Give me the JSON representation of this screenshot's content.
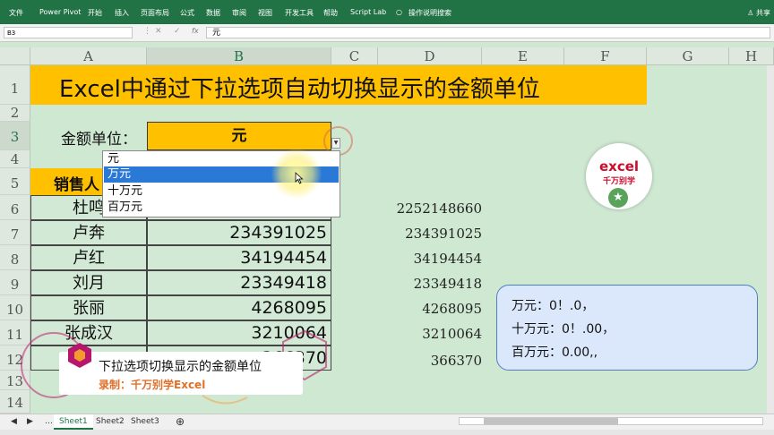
{
  "ribbon": {
    "tabs": [
      "文件",
      "Power Pivot",
      "开始",
      "插入",
      "页面布局",
      "公式",
      "数据",
      "审阅",
      "视图",
      "开发工具",
      "帮助",
      "Script Lab",
      "操作说明搜索"
    ],
    "share": "共享"
  },
  "formula_bar": {
    "name_box": "B3",
    "value": "元"
  },
  "columns": [
    "A",
    "B",
    "C",
    "D",
    "E",
    "F",
    "G",
    "H"
  ],
  "rows": [
    "1",
    "2",
    "3",
    "4",
    "5",
    "6",
    "7",
    "8",
    "9",
    "10",
    "11",
    "12",
    "13",
    "14"
  ],
  "sheet": {
    "title": "Excel中通过下拉选项自动切换显示的金额单位",
    "unit_label": "金额单位：",
    "unit_value": "元",
    "sales_header": "销售人",
    "data_rows": [
      {
        "name": "杜鸣",
        "value": ""
      },
      {
        "name": "卢奔",
        "value": "234391025"
      },
      {
        "name": "卢红",
        "value": "34194454"
      },
      {
        "name": "刘月",
        "value": "23349418"
      },
      {
        "name": "张丽",
        "value": "4268095"
      },
      {
        "name": "张成汉",
        "value": "3210064"
      },
      {
        "name": "",
        "value": "366370"
      }
    ],
    "column_d": [
      "2252148660",
      "234391025",
      "34194454",
      "23349418",
      "4268095",
      "3210064",
      "366370"
    ]
  },
  "dropdown": {
    "options": [
      "元",
      "万元",
      "十万元",
      "百万元"
    ],
    "highlighted_index": 1
  },
  "callout": {
    "lines": [
      "万元：0！.0，",
      "十万元：0！.00，",
      "百万元：0.00,,"
    ]
  },
  "logo": {
    "word": "excel",
    "sub": "千万别学"
  },
  "caption": {
    "line1": "下拉选项切换显示的金额单位",
    "line2": "录制：千万别学Excel"
  },
  "sheet_tabs": [
    "Sheet1",
    "Sheet2",
    "Sheet3"
  ],
  "colors": {
    "ribbon": "#217346",
    "highlight": "#ffc000",
    "selection": "#2b79d6",
    "sheet_bg": "#cfe8d2"
  }
}
